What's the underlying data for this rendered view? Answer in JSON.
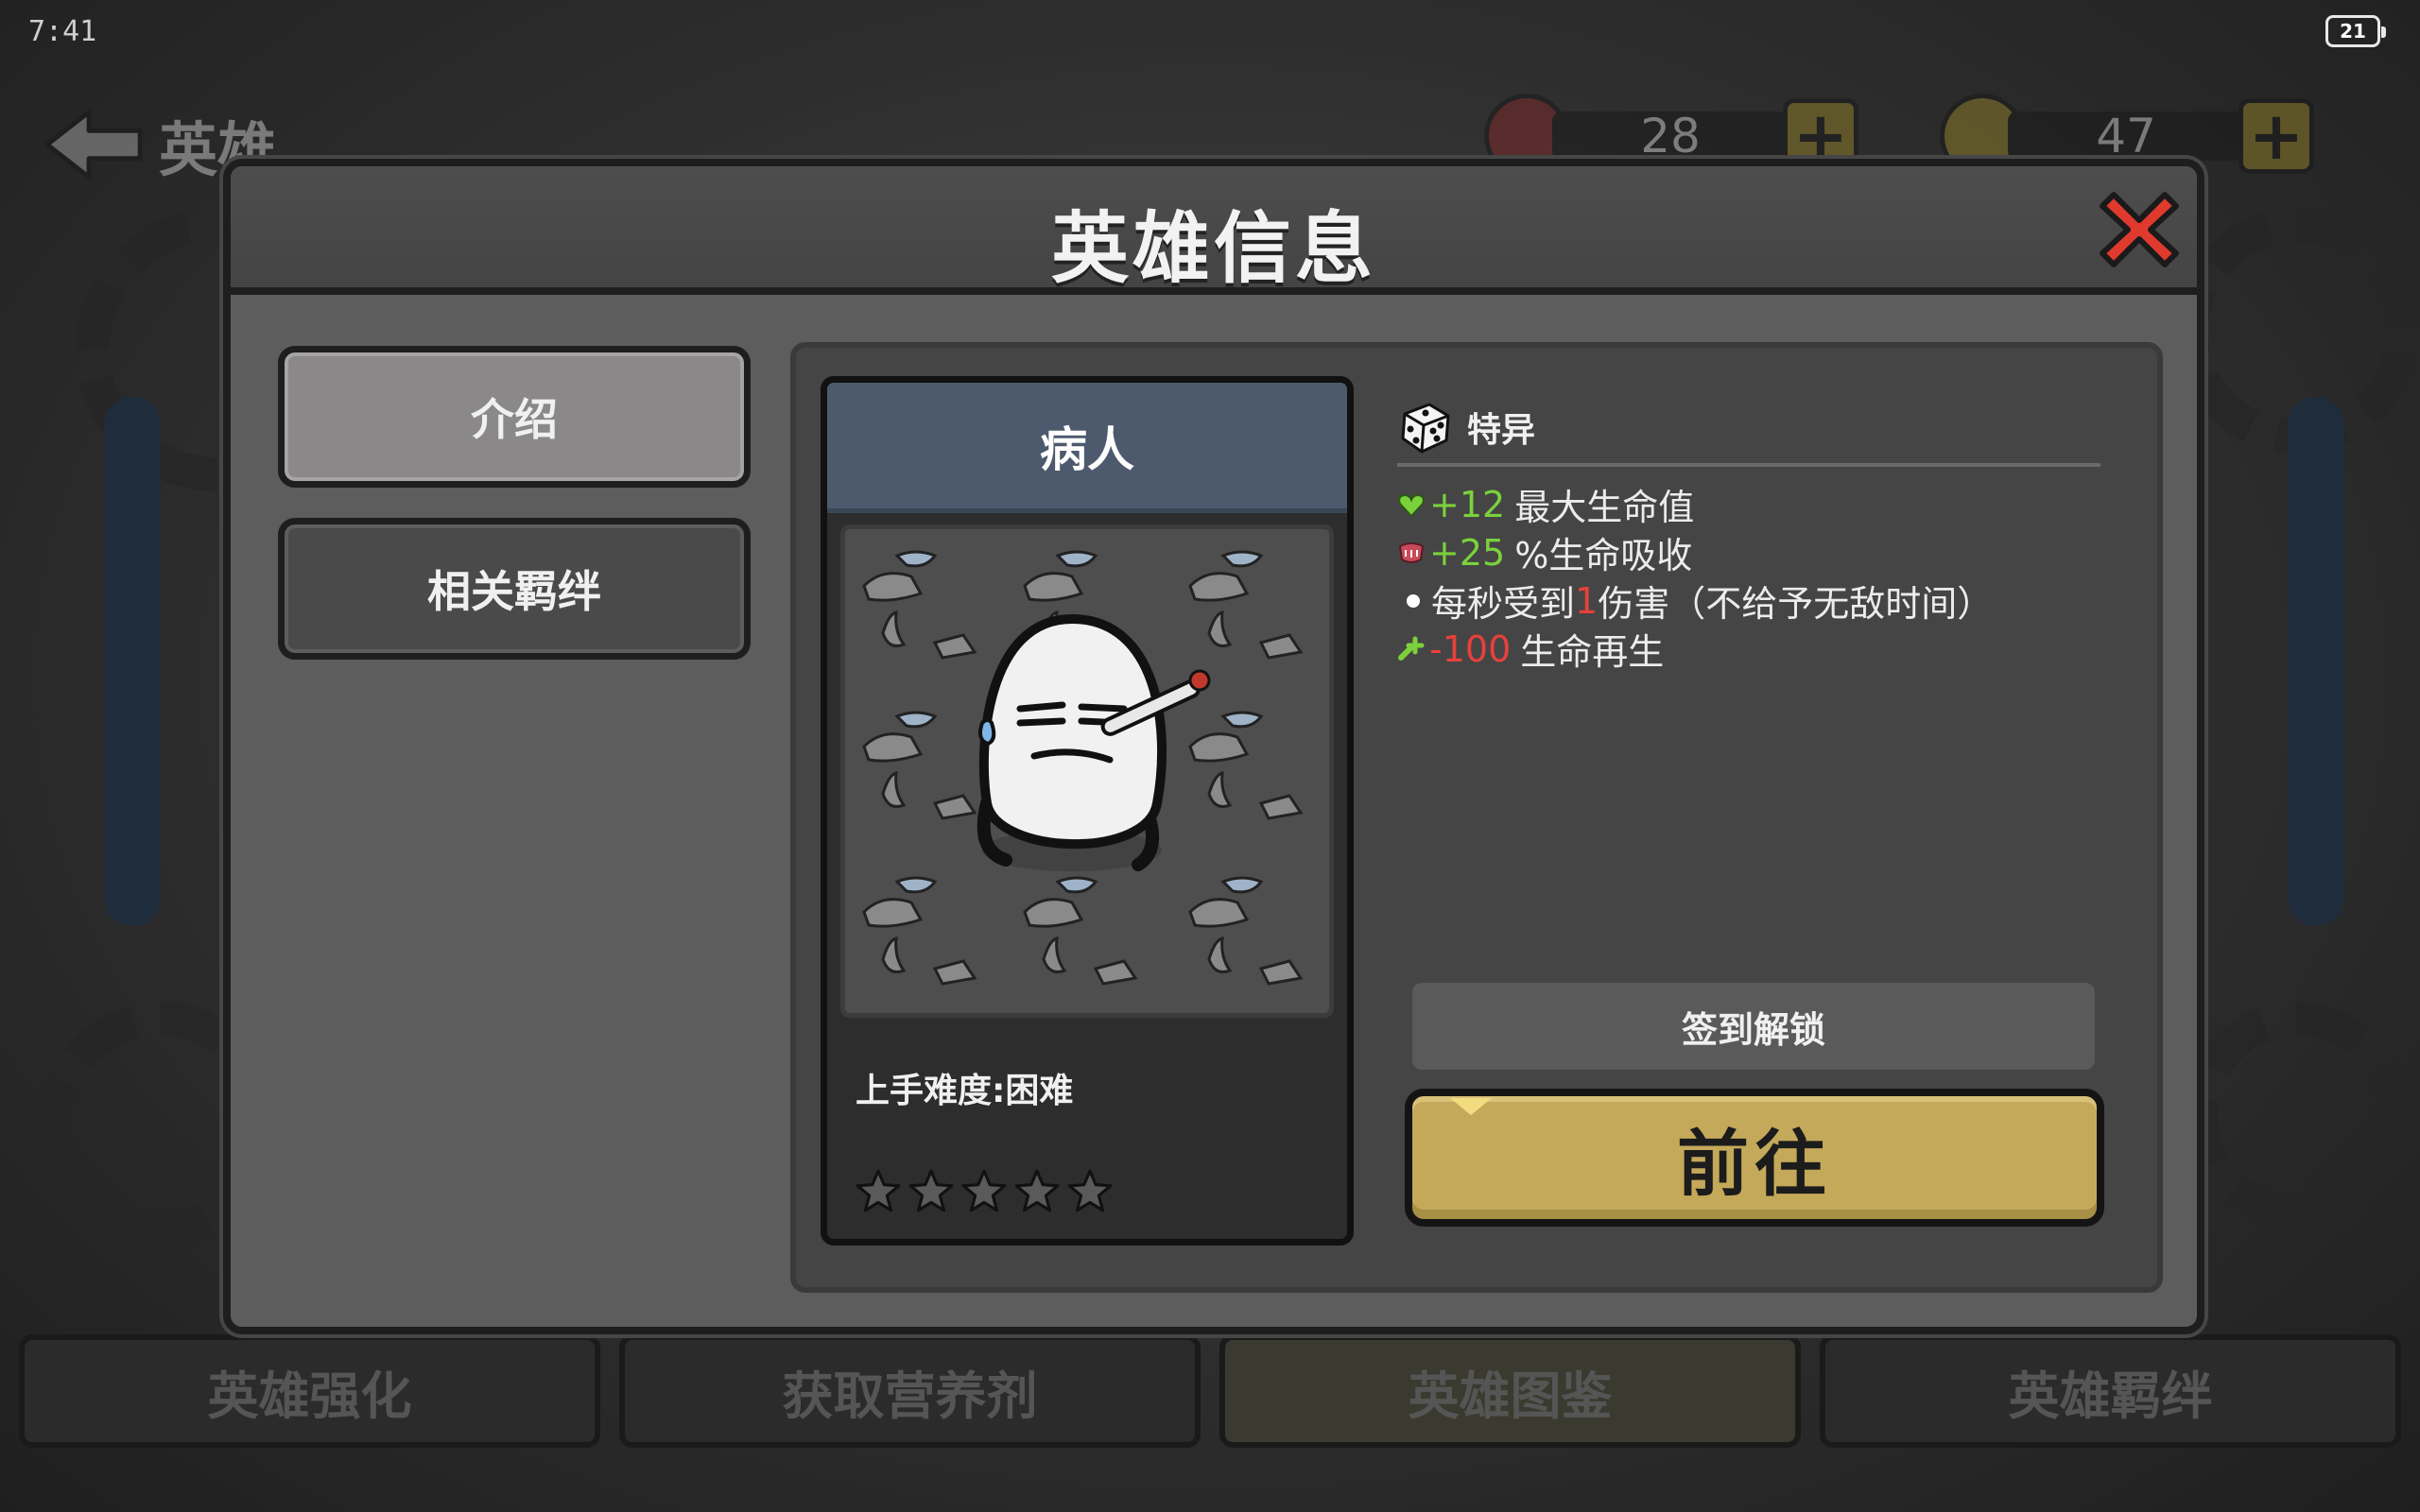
{
  "status_bar": {
    "time": "7:41",
    "battery": "21"
  },
  "background": {
    "back_label": "英雄",
    "gems": "28",
    "coins": "47",
    "bottom_tabs": [
      "英雄强化",
      "获取营养剂",
      "英雄图鉴",
      "英雄羁绊"
    ]
  },
  "modal": {
    "title": "英雄信息",
    "tabs": [
      {
        "label": "介绍",
        "active": true
      },
      {
        "label": "相关羁绊",
        "active": false
      }
    ],
    "hero": {
      "name": "病人",
      "difficulty": "上手难度:困难",
      "stars_total": 5,
      "stars_filled": 0
    },
    "traits": {
      "title": "特异",
      "lines": [
        {
          "icon": "heart-icon",
          "value": "+12",
          "value_color": "green",
          "label": "最大生命值"
        },
        {
          "icon": "lifesteal-icon",
          "value": "+25",
          "value_color": "green",
          "label": "%生命吸收"
        },
        {
          "icon": "bullet-icon",
          "prefix": "每秒受到",
          "value": "1",
          "value_color": "red",
          "suffix": "伤害（不给予无敌时间）"
        },
        {
          "icon": "regen-icon",
          "value": "-100",
          "value_color": "red",
          "label": "生命再生"
        }
      ]
    },
    "unlock_text": "签到解锁",
    "go_button": "前往"
  },
  "colors": {
    "accent_gold": "#c4a95a",
    "name_bar": "#4d5a6e",
    "positive": "#7bd13c",
    "negative": "#e8413a"
  }
}
